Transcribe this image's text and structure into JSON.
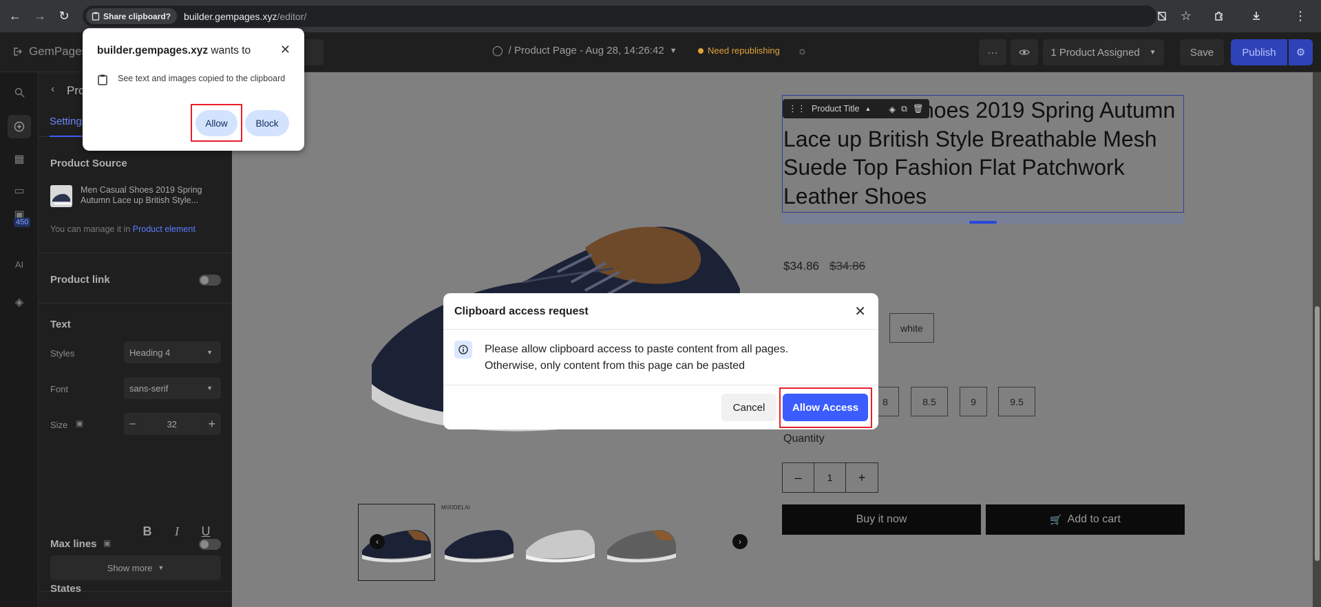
{
  "browser": {
    "share_chip": "Share clipboard?",
    "url_host": "builder.gempages.xyz",
    "url_path": "/editor/"
  },
  "header": {
    "logo_text": "GemPages",
    "doc_title": "/ Product Page - Aug 28, 14:26:42",
    "status_badge": "Need republishing",
    "more_label": "···",
    "assigned": "1 Product Assigned",
    "save": "Save",
    "publish": "Publish"
  },
  "rail": {
    "badge": "450",
    "ai_label": "AI"
  },
  "panel": {
    "back_label": "Product Title",
    "tab_settings": "Settings",
    "product_source_title": "Product Source",
    "product_name": "Men Casual Shoes 2019 Spring Autumn Lace up British Style...",
    "manage_prefix": "You can manage it in",
    "manage_link": "Product element",
    "product_link": "Product link",
    "text_section": "Text",
    "styles_label": "Styles",
    "styles_value": "Heading 4",
    "font_label": "Font",
    "font_value": "sans-serif",
    "size_label": "Size",
    "size_value": "32",
    "bold": "B",
    "italic": "I",
    "underline": "U",
    "show_more": "Show more",
    "max_lines": "Max lines",
    "states": "States"
  },
  "product": {
    "title": "Men Casual Shoes 2019 Spring Autumn Lace up British Style Breathable Mesh Suede Top Fashion Flat Patchwork Leather Shoes",
    "toolbar_label": "Product Title",
    "price": "$34.86",
    "compare_price": "$34.86",
    "colors": [
      "white"
    ],
    "sizes": [
      "8",
      "8.5",
      "9",
      "9.5"
    ],
    "quantity_label": "Quantity",
    "quantity": "1",
    "buy_now": "Buy it now",
    "add_to_cart": "Add to cart",
    "brand_tag": "MIXIDELAI"
  },
  "permission_popup": {
    "site": "builder.gempages.xyz",
    "wants_to": "wants to",
    "description": "See text and images copied to the clipboard",
    "allow": "Allow",
    "block": "Block"
  },
  "modal": {
    "title": "Clipboard access request",
    "text_line1": "Please allow clipboard access to paste content from all pages.",
    "text_line2": "Otherwise, only content from this page can be pasted",
    "cancel": "Cancel",
    "allow_access": "Allow Access"
  }
}
